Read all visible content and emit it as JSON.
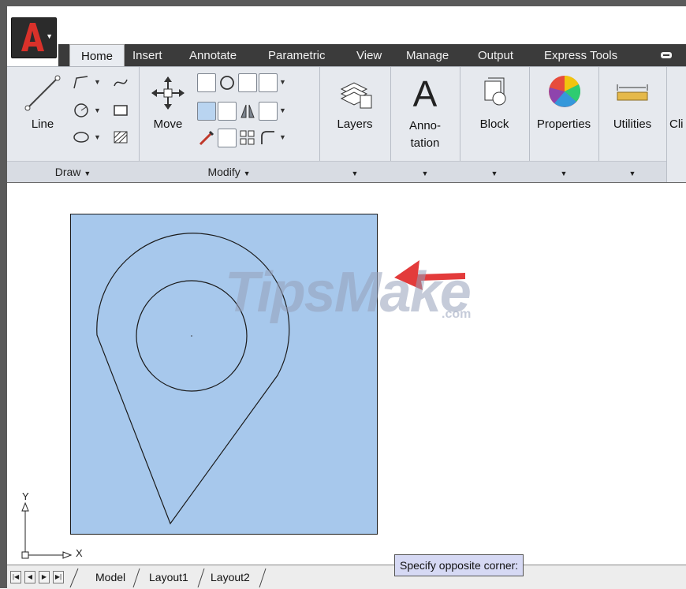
{
  "tabs": [
    "Home",
    "Insert",
    "Annotate",
    "Parametric",
    "View",
    "Manage",
    "Output",
    "Express Tools"
  ],
  "active_tab": "Home",
  "ribbon": {
    "draw": {
      "line_label": "Line",
      "title": "Draw"
    },
    "modify": {
      "move_label": "Move",
      "title": "Modify"
    },
    "layers_label": "Layers",
    "annotation_label": "Anno-\ntation",
    "block_label": "Block",
    "properties_label": "Properties",
    "utilities_label": "Utilities",
    "clipboard_label_partial": "Cli"
  },
  "watermark": {
    "text": "TipsMake",
    "suffix": ".com"
  },
  "ucs": {
    "x_label": "X",
    "y_label": "Y"
  },
  "layout_tabs": [
    "Model",
    "Layout1",
    "Layout2"
  ],
  "tooltip": "Specify opposite corner:",
  "colors": {
    "selection": "#a7c8ec",
    "arrow": "#e33b3b",
    "tab_bar": "#3b3b3b",
    "ribbon": "#e6e9ee"
  }
}
